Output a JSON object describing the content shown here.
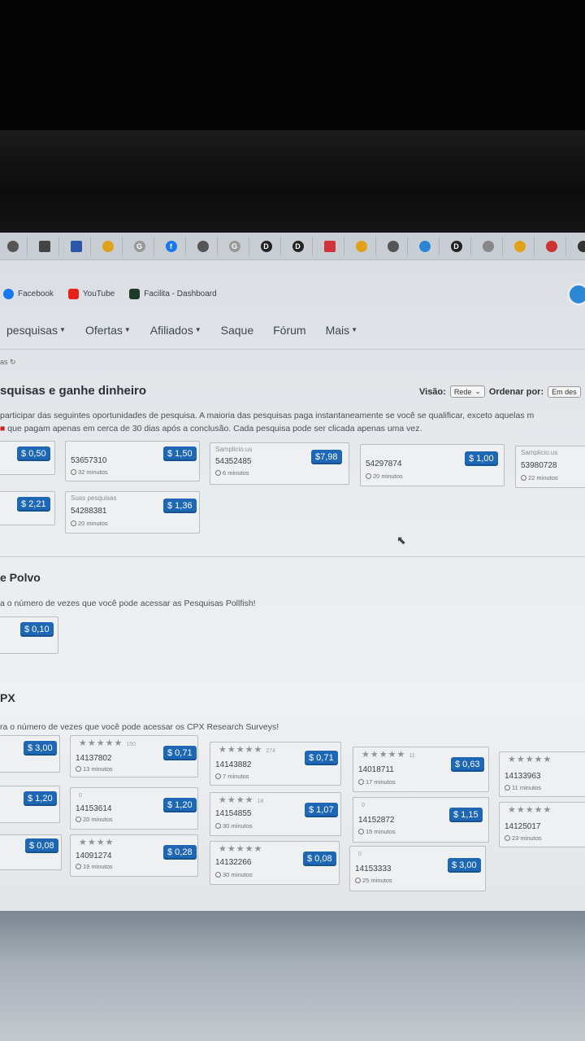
{
  "browser": {
    "bookmarks": [
      {
        "label": "Facebook",
        "color": "#1877f2"
      },
      {
        "label": "YouTube",
        "color": "#ff0000"
      },
      {
        "label": "Facilita - Dashboard",
        "color": "#1d3a2a"
      }
    ]
  },
  "nav": {
    "items": [
      "pesquisas",
      "Ofertas",
      "Afiliados",
      "Saque",
      "Fórum",
      "Mais"
    ]
  },
  "breadcrumb": "as",
  "main": {
    "title": "squisas e ganhe dinheiro",
    "visao_label": "Visão:",
    "visao_value": "Rede",
    "ordenar_label": "Ordenar por:",
    "ordenar_value": "Em des",
    "desc_line1": "participar das seguintes oportunidades de pesquisa. A maioria das pesquisas paga instantaneamente se você se qualificar, exceto aquelas m",
    "desc_line2": "que pagam apenas em cerca de 30 dias após a conclusão. Cada pesquisa pode ser clicada apenas uma vez.",
    "cards": [
      {
        "price": "$ 0,50",
        "tag": "",
        "id": "",
        "duration": ""
      },
      {
        "price": "$ 1,50",
        "tag": "",
        "id": "53657310",
        "duration": "32 minutos"
      },
      {
        "price": "$7,98",
        "tag": "Samplicio.us",
        "id": "54352485",
        "duration": "6 minutos"
      },
      {
        "price": "$ 1,00",
        "tag": "",
        "id": "54297874",
        "duration": "20 minutos"
      },
      {
        "price": "",
        "tag": "Samplicio.us",
        "id": "53980728",
        "duration": "22 minutos"
      },
      {
        "price": "$ 2,21",
        "tag": "",
        "id": "",
        "duration": ""
      },
      {
        "price": "$ 1,36",
        "tag": "Suas pesquisas",
        "id": "54288381",
        "duration": "20 minutos"
      }
    ]
  },
  "polvo": {
    "title": "e Polvo",
    "desc": "a o número de vezes que você pode acessar as Pesquisas Pollfish!",
    "price": "$ 0,10"
  },
  "cpx": {
    "title": "PX",
    "desc": "ra o número de vezes que você pode acessar os CPX Research Surveys!",
    "cards": [
      {
        "price": "$ 3,00",
        "id": "",
        "duration": "",
        "stars": "",
        "count": ""
      },
      {
        "price": "$ 0,71",
        "id": "14137802",
        "duration": "13 minutos",
        "stars": "★★★★★",
        "count": "150"
      },
      {
        "price": "$ 0,71",
        "id": "14143882",
        "duration": "7 minutos",
        "stars": "★★★★★",
        "count": "274"
      },
      {
        "price": "$ 0,63",
        "id": "14018711",
        "duration": "17 minutos",
        "stars": "★★★★★",
        "count": "11"
      },
      {
        "price": "",
        "id": "14133963",
        "duration": "11 minutos",
        "stars": "★★★★★",
        "count": ""
      },
      {
        "price": "$ 1,20",
        "id": "",
        "duration": "",
        "stars": "",
        "count": ""
      },
      {
        "price": "$ 1,20",
        "id": "14153614",
        "duration": "20 minutos",
        "stars": "",
        "count": "0"
      },
      {
        "price": "$ 1,07",
        "id": "14154855",
        "duration": "30 minutos",
        "stars": "★★★★",
        "count": "18"
      },
      {
        "price": "$ 1,15",
        "id": "14152872",
        "duration": "15 minutos",
        "stars": "",
        "count": "0"
      },
      {
        "price": "",
        "id": "14125017",
        "duration": "23 minutos",
        "stars": "★★★★★",
        "count": ""
      },
      {
        "price": "$ 0,08",
        "id": "",
        "duration": "",
        "stars": "",
        "count": ""
      },
      {
        "price": "$ 0,28",
        "id": "14091274",
        "duration": "19 minutos",
        "stars": "★★★★",
        "count": ""
      },
      {
        "price": "$ 0,08",
        "id": "14132266",
        "duration": "30 minutos",
        "stars": "★★★★★",
        "count": ""
      },
      {
        "price": "$ 3,00",
        "id": "14153333",
        "duration": "25 minutos",
        "stars": "",
        "count": "0"
      }
    ]
  }
}
